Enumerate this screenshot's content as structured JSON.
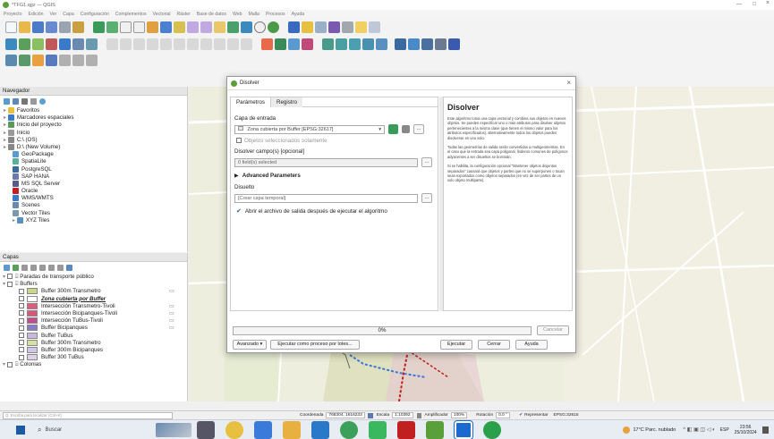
{
  "window": {
    "title": "*TFG1.qgz — QGIS",
    "controls": [
      "—",
      "□",
      "×"
    ]
  },
  "menubar": [
    "Proyecto",
    "Edición",
    "Ver",
    "Capa",
    "Configuración",
    "Complementos",
    "Vectorial",
    "Ráster",
    "Base de datos",
    "Web",
    "Malla",
    "Procesos",
    "Ayuda"
  ],
  "browser": {
    "title": "Navegador",
    "items": [
      "Favoritos",
      "Marcadores espaciales",
      "Inicio del proyecto",
      "Inicio",
      "C:\\ (OS)",
      "D:\\ (New Volume)",
      "GeoPackage",
      "SpatiaLite",
      "PostgreSQL",
      "SAP HANA",
      "MS SQL Server",
      "Oracle",
      "WMS/WMTS",
      "Scenes",
      "Vector Tiles",
      "XYZ Tiles"
    ]
  },
  "layers": {
    "title": "Capas",
    "items": [
      {
        "label": "Paradas de transporte público",
        "color": "",
        "bold": false,
        "indent": 1
      },
      {
        "label": "Buffers",
        "color": "",
        "bold": false,
        "indent": 1
      },
      {
        "label": "Buffer 300m Transmetro",
        "color": "#c8d88a",
        "bold": false,
        "indent": 2
      },
      {
        "label": "Zona cubierta por Buffer",
        "color": "#ffffff",
        "bold": true,
        "indent": 2
      },
      {
        "label": "Intersección Transmetro-Tivoli",
        "color": "#e05a7a",
        "bold": false,
        "indent": 2
      },
      {
        "label": "Intersección Bicipanques-Tivoli",
        "color": "#d9567a",
        "bold": false,
        "indent": 2
      },
      {
        "label": "Intersección TuBus-Tivoli",
        "color": "#c94a8a",
        "bold": false,
        "indent": 2
      },
      {
        "label": "Buffer Bicipanques",
        "color": "#8a7ac8",
        "bold": false,
        "indent": 2
      },
      {
        "label": "Buffer TuBus",
        "color": "#c8b8e0",
        "bold": false,
        "indent": 2
      },
      {
        "label": "Buffer 300m Transmetro",
        "color": "#d8e0a0",
        "bold": false,
        "indent": 2
      },
      {
        "label": "Buffer 300m Bicipanques",
        "color": "#d0c8e8",
        "bold": false,
        "indent": 2
      },
      {
        "label": "Buffer 300 TuBus",
        "color": "#e0d0e8",
        "bold": false,
        "indent": 2
      },
      {
        "label": "Colonias",
        "color": "",
        "bold": false,
        "indent": 1
      }
    ]
  },
  "search": {
    "placeholder": "Q. Escriba para localizar (Ctrl+K)"
  },
  "dialog": {
    "title": "Disolver",
    "tabs": [
      "Parámetros",
      "Registro"
    ],
    "input_label": "Capa de entrada",
    "input_value": "Zona cubierta por Buffer [EPSG:32617]",
    "selected_only": "Objetos seleccionados solamente",
    "dissolve_label": "Disolver campo(s) [opcional]",
    "dissolve_value": "0 field(s) selected",
    "advanced": "Advanced Parameters",
    "output_label": "Disuelto",
    "output_placeholder": "[Crear capa temporal]",
    "open_after": "Abrir el archivo de salida después de ejecutar el algoritmo",
    "progress": "0%",
    "cancel": "Cancelar",
    "advanced_btn": "Avanzado",
    "batch_btn": "Ejecutar como proceso por lotes...",
    "run": "Ejecutar",
    "close": "Cerrar",
    "help": "Ayuda",
    "help_title": "Disolver",
    "help_p1": "Este algoritmo toma una capa vectorial y combina sus objetos en nuevos objetos. Se pueden especificar uno o más atributos para disolver objetos pertenecientes a la misma clase (que tienen el mismo valor para los atributos especificados), alternativamente todos los objetos pueden disolverse en uno solo.",
    "help_p2": "Todas las geometrías de salida serán convertidas a multigeometrías. En el caso que la entrada sea capa poligonal, linderos comunes de polígonos adyacentes a ser disueltos se borrarán.",
    "help_p3": "Si se habilita, la configuración opcional \"Mantener objetos disjuntos separados\" causará que objetos y partes que no se superponen o tocan sean exportados como objetos separados (en vez de ser partes de un solo objeto multiparte)."
  },
  "statusbar": {
    "coord_label": "Coordenada",
    "coord": "768304, 1616233",
    "scale_label": "Escala",
    "scale": "1:10392",
    "mag_label": "Amplificador",
    "mag": "100%",
    "rot_label": "Rotación",
    "rot": "0.0 °",
    "render": "Representar",
    "crs": "EPSG:32615"
  },
  "taskbar": {
    "search": "Buscar",
    "weather": "17°C Parc. nublado",
    "lang": "ESP",
    "time": "23:56",
    "date": "25/10/2024"
  },
  "colors": {
    "accent": "#3a78c8",
    "map_bg": "#eef0dc",
    "buffer_green": "#d6dcaa",
    "red_route": "#c02020",
    "blue_route": "#3a78d8"
  }
}
